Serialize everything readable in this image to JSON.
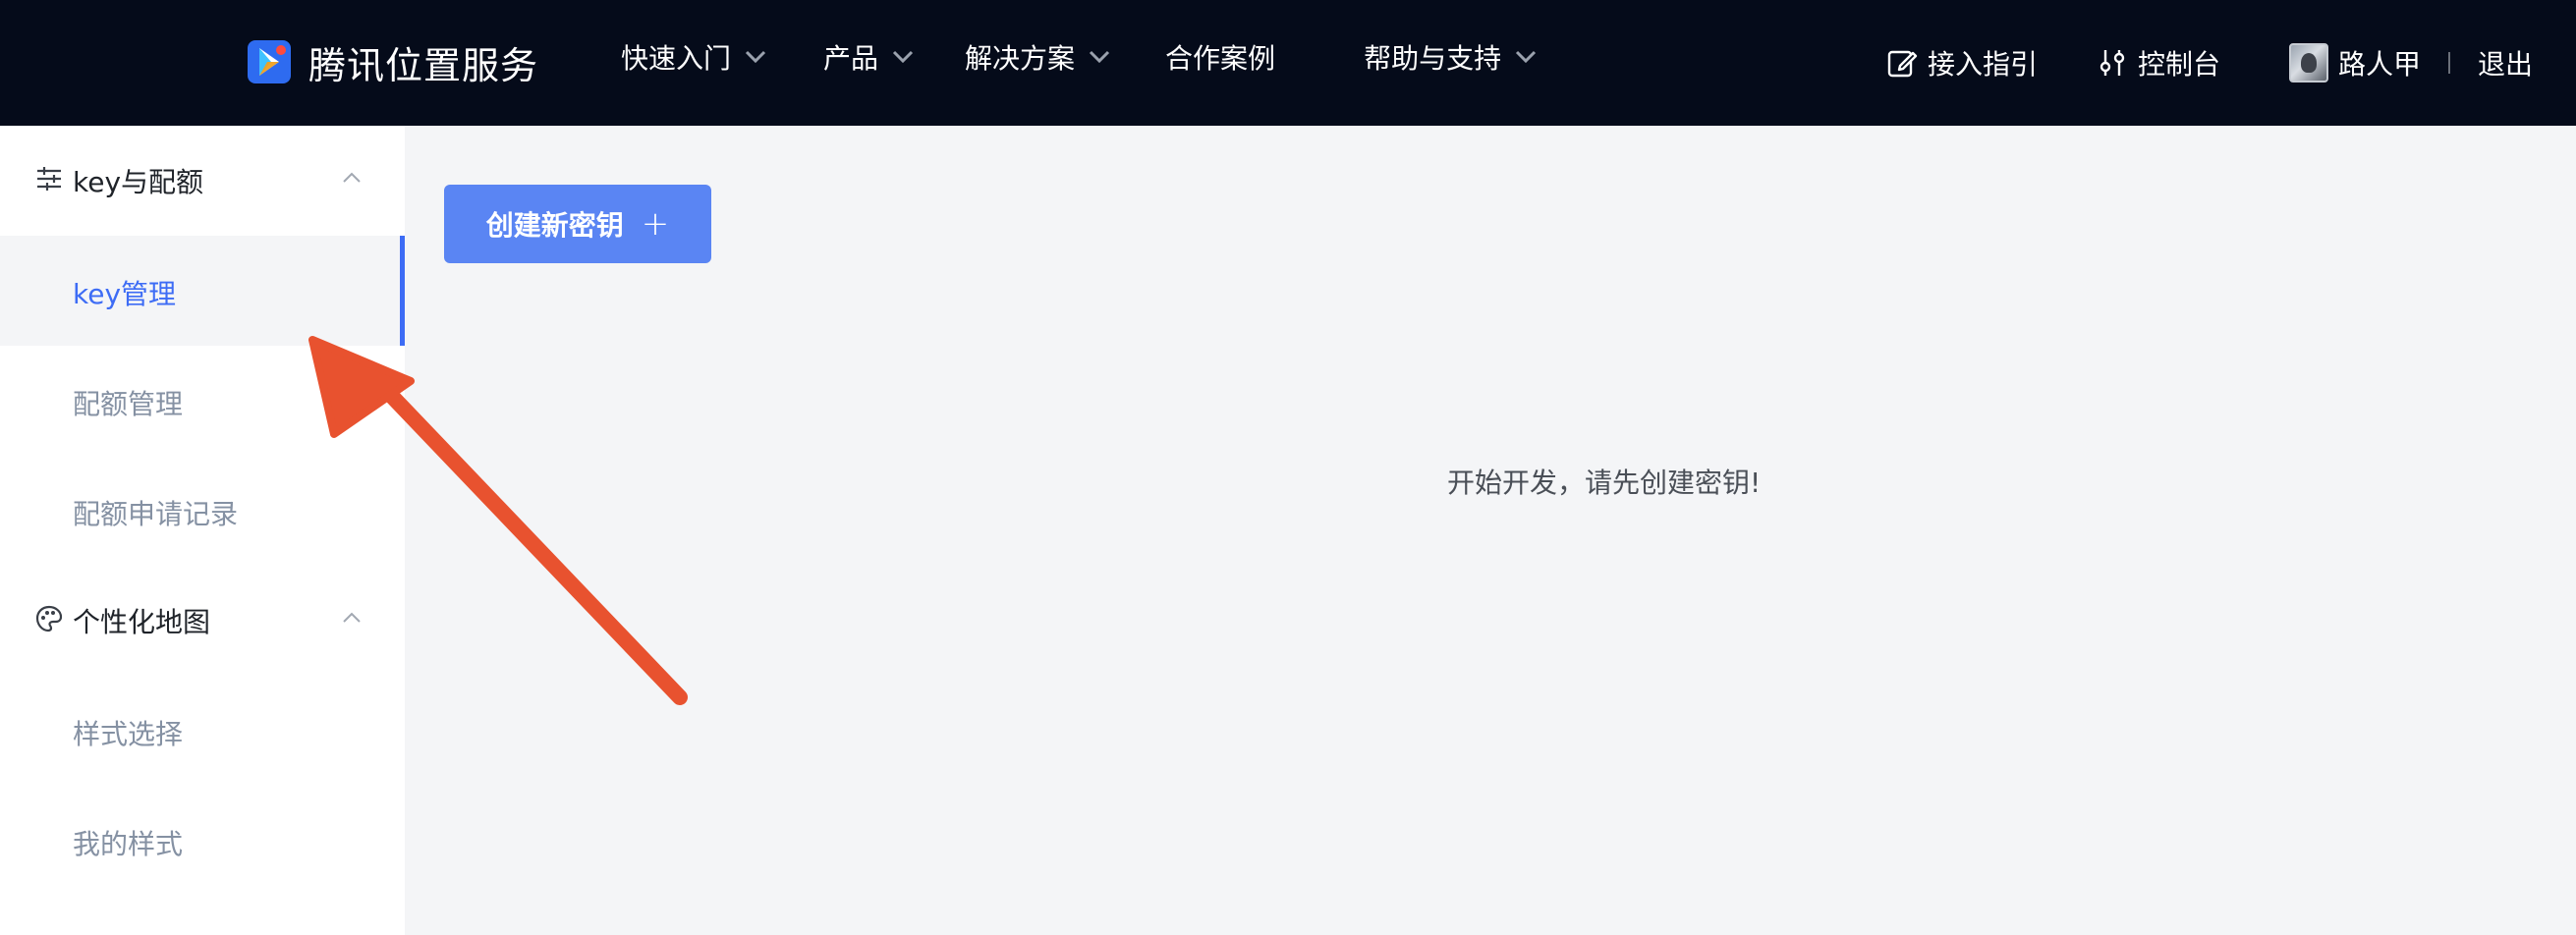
{
  "header": {
    "brand": "腾讯位置服务",
    "nav": [
      {
        "label": "快速入门",
        "has_dropdown": true
      },
      {
        "label": "产品",
        "has_dropdown": true
      },
      {
        "label": "解决方案",
        "has_dropdown": true
      },
      {
        "label": "合作案例",
        "has_dropdown": false
      },
      {
        "label": "帮助与支持",
        "has_dropdown": true
      }
    ],
    "right": {
      "guide": "接入指引",
      "console": "控制台",
      "username": "路人甲",
      "logout": "退出"
    }
  },
  "sidebar": {
    "groups": [
      {
        "label": "key与配额",
        "icon": "sliders-icon",
        "items": [
          {
            "label": "key管理",
            "active": true
          },
          {
            "label": "配额管理",
            "active": false
          },
          {
            "label": "配额申请记录",
            "active": false
          }
        ]
      },
      {
        "label": "个性化地图",
        "icon": "palette-icon",
        "items": [
          {
            "label": "样式选择",
            "active": false
          },
          {
            "label": "我的样式",
            "active": false
          }
        ]
      }
    ]
  },
  "main": {
    "create_button": "创建新密钥",
    "empty_message": "开始开发，请先创建密钥!"
  },
  "colors": {
    "topbar_bg": "#050b1a",
    "accent": "#3d6cf5",
    "button_bg": "#5a85f3",
    "arrow": "#e8522f"
  }
}
